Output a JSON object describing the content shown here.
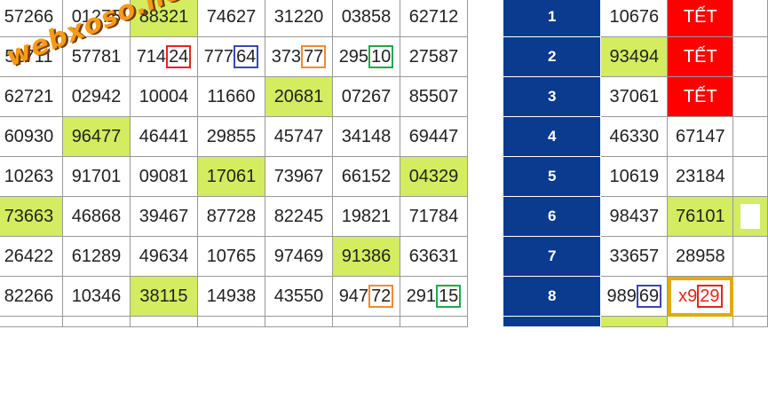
{
  "left_grid": [
    [
      "57266",
      "01275",
      "88321",
      "74627",
      "31220",
      "03858",
      "62712"
    ],
    [
      "51711",
      "57781",
      "71424",
      "77764",
      "37377",
      "29510",
      "27587"
    ],
    [
      "62721",
      "02942",
      "10004",
      "11660",
      "20681",
      "07267",
      "85507"
    ],
    [
      "60930",
      "96477",
      "46441",
      "29855",
      "45747",
      "34148",
      "69447"
    ],
    [
      "10263",
      "91701",
      "09081",
      "17061",
      "73967",
      "66152",
      "04329"
    ],
    [
      "73663",
      "46868",
      "39467",
      "87728",
      "82245",
      "19821",
      "71784"
    ],
    [
      "26422",
      "61289",
      "49634",
      "10765",
      "97469",
      "91386",
      "63631"
    ],
    [
      "82266",
      "10346",
      "38115",
      "14938",
      "43550",
      "94772",
      "29115"
    ]
  ],
  "right_grid": [
    {
      "num": "1",
      "a": "10676",
      "b": "TẾT"
    },
    {
      "num": "2",
      "a": "93494",
      "b": "TẾT"
    },
    {
      "num": "3",
      "a": "37061",
      "b": "TẾT"
    },
    {
      "num": "4",
      "a": "46330",
      "b": "67147"
    },
    {
      "num": "5",
      "a": "10619",
      "b": "23184"
    },
    {
      "num": "6",
      "a": "98437",
      "b": "76101"
    },
    {
      "num": "7",
      "a": "33657",
      "b": "28958"
    },
    {
      "num": "8",
      "a": "98969",
      "b": "x929"
    }
  ],
  "watermark": "webxoso.net",
  "colors": {
    "highlight": "#d3ec60",
    "header_blue": "#0b3b8f",
    "tet_red": "#ff0000",
    "gold": "#e0ac00"
  }
}
